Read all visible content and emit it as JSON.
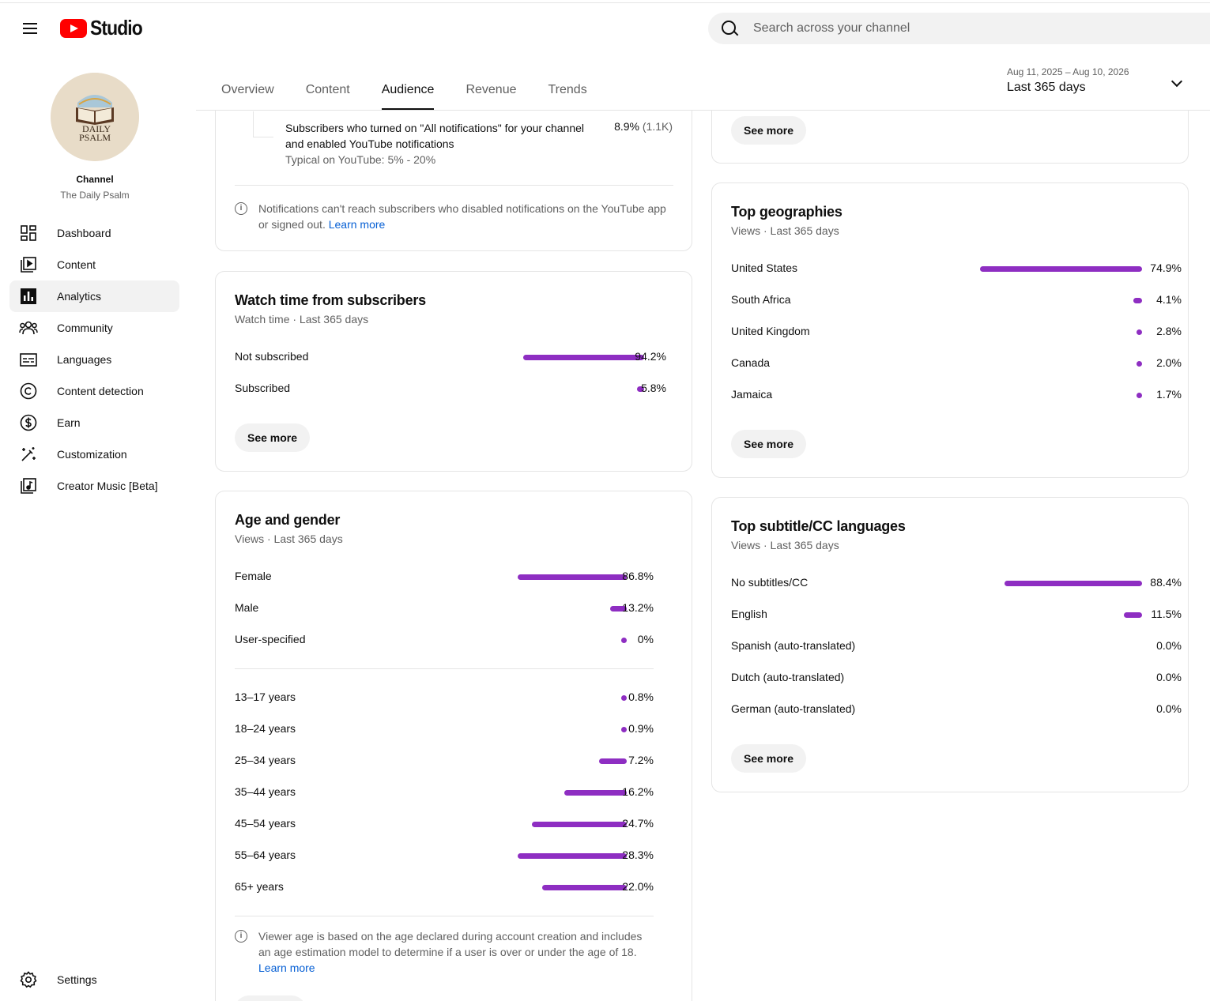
{
  "header": {
    "logo_text": "Studio",
    "search_placeholder": "Search across your channel"
  },
  "channel": {
    "label": "Channel",
    "name": "The Daily Psalm",
    "avatar_text_line1": "DAILY",
    "avatar_text_line2": "PSALM"
  },
  "sidebar": {
    "items": [
      {
        "label": "Dashboard",
        "icon": "dashboard-icon"
      },
      {
        "label": "Content",
        "icon": "content-icon"
      },
      {
        "label": "Analytics",
        "icon": "analytics-icon",
        "active": true
      },
      {
        "label": "Community",
        "icon": "community-icon"
      },
      {
        "label": "Languages",
        "icon": "languages-icon"
      },
      {
        "label": "Content detection",
        "icon": "copyright-icon"
      },
      {
        "label": "Earn",
        "icon": "dollar-icon"
      },
      {
        "label": "Customization",
        "icon": "magic-wand-icon"
      },
      {
        "label": "Creator Music [Beta]",
        "icon": "music-icon"
      }
    ],
    "settings_label": "Settings"
  },
  "tabs": [
    "Overview",
    "Content",
    "Audience",
    "Revenue",
    "Trends"
  ],
  "active_tab": "Audience",
  "date_range": {
    "range": "Aug 11, 2025 – Aug 10, 2026",
    "label": "Last 365 days"
  },
  "colors": {
    "bar": "#8e2ec2",
    "link": "#065fd4"
  },
  "notifications_card": {
    "row_text_line1": "Subscribers who turned on \"All notifications\" for your channel",
    "row_text_line2": "and enabled YouTube notifications",
    "typical": "Typical on YouTube: 5% - 20%",
    "value": "8.9%",
    "value_count": "(1.1K)",
    "info_text_line1": "Notifications can't reach subscribers who disabled notifications on the YouTube app",
    "info_text_line2": "or signed out.",
    "learn_more": "Learn more"
  },
  "watch_time_card": {
    "title": "Watch time from subscribers",
    "subtitle": "Watch time · Last 365 days",
    "rows": [
      {
        "label": "Not subscribed",
        "value": "94.2%",
        "fraction": 0.942
      },
      {
        "label": "Subscribed",
        "value": "5.8%",
        "fraction": 0.058
      }
    ],
    "see_more": "See more"
  },
  "age_gender_card": {
    "title": "Age and gender",
    "subtitle": "Views · Last 365 days",
    "gender_rows": [
      {
        "label": "Female",
        "value": "86.8%",
        "fraction": 0.868
      },
      {
        "label": "Male",
        "value": "13.2%",
        "fraction": 0.132
      },
      {
        "label": "User-specified",
        "value": "0%",
        "fraction": 0
      }
    ],
    "age_rows": [
      {
        "label": "13–17 years",
        "value": "0.8%",
        "fraction": 0.008
      },
      {
        "label": "18–24 years",
        "value": "0.9%",
        "fraction": 0.009
      },
      {
        "label": "25–34 years",
        "value": "7.2%",
        "fraction": 0.072
      },
      {
        "label": "35–44 years",
        "value": "16.2%",
        "fraction": 0.162
      },
      {
        "label": "45–54 years",
        "value": "24.7%",
        "fraction": 0.247
      },
      {
        "label": "55–64 years",
        "value": "28.3%",
        "fraction": 0.283
      },
      {
        "label": "65+ years",
        "value": "22.0%",
        "fraction": 0.22
      }
    ],
    "info_text_line1": "Viewer age is based on the age declared during account creation and includes",
    "info_text_line2": "an age estimation model to determine if a user is over or under the age of 18.",
    "learn_more": "Learn more"
  },
  "top_card": {
    "see_more": "See more"
  },
  "geographies_card": {
    "title": "Top geographies",
    "subtitle": "Views · Last 365 days",
    "rows": [
      {
        "label": "United States",
        "value": "74.9%",
        "fraction": 0.749
      },
      {
        "label": "South Africa",
        "value": "4.1%",
        "fraction": 0.041
      },
      {
        "label": "United Kingdom",
        "value": "2.8%",
        "fraction": 0.028
      },
      {
        "label": "Canada",
        "value": "2.0%",
        "fraction": 0.02
      },
      {
        "label": "Jamaica",
        "value": "1.7%",
        "fraction": 0.017
      }
    ],
    "see_more": "See more"
  },
  "subtitles_card": {
    "title": "Top subtitle/CC languages",
    "subtitle": "Views · Last 365 days",
    "rows": [
      {
        "label": "No subtitles/CC",
        "value": "88.4%",
        "fraction": 0.884
      },
      {
        "label": "English",
        "value": "11.5%",
        "fraction": 0.115
      },
      {
        "label": "Spanish (auto-translated)",
        "value": "0.0%",
        "fraction": 0
      },
      {
        "label": "Dutch (auto-translated)",
        "value": "0.0%",
        "fraction": 0
      },
      {
        "label": "German (auto-translated)",
        "value": "0.0%",
        "fraction": 0
      }
    ],
    "see_more": "See more"
  }
}
